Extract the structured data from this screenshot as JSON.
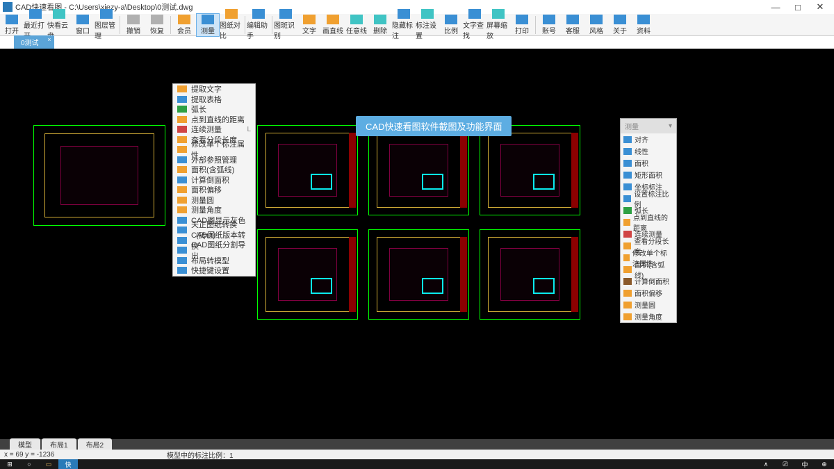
{
  "title": "CAD快速看图 - C:\\Users\\xiezy-a\\Desktop\\0测试.dwg",
  "winbtns": {
    "min": "—",
    "max": "□",
    "close": "✕"
  },
  "toolbar": [
    {
      "id": "open",
      "label": "打开",
      "c": "c-blue"
    },
    {
      "id": "recent",
      "label": "最近打开",
      "c": "c-blue"
    },
    {
      "id": "cloud",
      "label": "快看云盘",
      "c": "c-cyan"
    },
    {
      "id": "window",
      "label": "窗口",
      "c": "c-blue"
    },
    {
      "id": "layer",
      "label": "图层管理",
      "c": "c-blue"
    },
    {
      "sep": true
    },
    {
      "id": "undo",
      "label": "撤销",
      "c": "c-gray"
    },
    {
      "id": "redo",
      "label": "恢复",
      "c": "c-gray"
    },
    {
      "sep": true
    },
    {
      "id": "vip",
      "label": "会员",
      "c": "c-orange"
    },
    {
      "id": "measure",
      "label": "测量",
      "c": "c-blue",
      "hl": true
    },
    {
      "id": "compare",
      "label": "图纸对比",
      "c": "c-orange"
    },
    {
      "sep": true
    },
    {
      "id": "edit",
      "label": "编辑助手",
      "c": "c-blue"
    },
    {
      "sep": true
    },
    {
      "id": "imgrec",
      "label": "图斑识别",
      "c": "c-blue"
    },
    {
      "id": "text",
      "label": "文字",
      "c": "c-orange"
    },
    {
      "id": "line",
      "label": "画直线",
      "c": "c-orange"
    },
    {
      "id": "anyline",
      "label": "任意线",
      "c": "c-cyan"
    },
    {
      "id": "delete",
      "label": "删除",
      "c": "c-cyan"
    },
    {
      "id": "hide",
      "label": "隐藏标注",
      "c": "c-blue"
    },
    {
      "id": "annset",
      "label": "标注设置",
      "c": "c-cyan"
    },
    {
      "id": "ratio",
      "label": "比例",
      "c": "c-blue"
    },
    {
      "id": "find",
      "label": "文字查找",
      "c": "c-blue"
    },
    {
      "id": "scale",
      "label": "屏幕缩放",
      "c": "c-cyan"
    },
    {
      "id": "print",
      "label": "打印",
      "c": "c-blue"
    },
    {
      "sep": true
    },
    {
      "id": "account",
      "label": "账号",
      "c": "c-blue"
    },
    {
      "id": "service",
      "label": "客服",
      "c": "c-blue"
    },
    {
      "id": "style",
      "label": "风格",
      "c": "c-blue"
    },
    {
      "id": "about",
      "label": "关于",
      "c": "c-blue"
    },
    {
      "id": "material",
      "label": "资料",
      "c": "c-blue"
    }
  ],
  "doctab": {
    "label": "0测试",
    "close": "×"
  },
  "dropdown": [
    {
      "label": "提取文字",
      "c": "c-orange"
    },
    {
      "label": "提取表格",
      "c": "c-blue"
    },
    {
      "label": "弧长",
      "c": "c-green"
    },
    {
      "label": "点到直线的距离",
      "c": "c-orange"
    },
    {
      "label": "连续测量",
      "key": "L",
      "c": "c-red"
    },
    {
      "label": "查看分段长度",
      "c": "c-orange"
    },
    {
      "label": "修改单个标注属性",
      "c": "c-orange"
    },
    {
      "label": "外部参照管理",
      "c": "c-blue"
    },
    {
      "label": "面积(含弧线)",
      "c": "c-orange"
    },
    {
      "label": "计算倒面积",
      "c": "c-blue"
    },
    {
      "label": "面积偏移",
      "c": "c-orange"
    },
    {
      "label": "测量圆",
      "c": "c-orange"
    },
    {
      "label": "测量角度",
      "c": "c-orange"
    },
    {
      "label": "CAD图显示灰色",
      "c": "c-blue"
    },
    {
      "label": "天正图纸转换（砖t3）",
      "c": "c-blue"
    },
    {
      "label": "CAD图纸版本转换",
      "c": "c-blue"
    },
    {
      "label": "CAD图纸分割导出",
      "c": "c-blue"
    },
    {
      "label": "布局转模型",
      "c": "c-blue"
    },
    {
      "label": "快捷键设置",
      "c": "c-blue"
    }
  ],
  "banner": "CAD快速看图软件截图及功能界面",
  "panel": {
    "header": "测量",
    "items": [
      {
        "label": "对齐",
        "c": "c-blue"
      },
      {
        "label": "线性",
        "c": "c-blue"
      },
      {
        "label": "面积",
        "c": "c-blue"
      },
      {
        "label": "矩形面积",
        "c": "c-blue"
      },
      {
        "label": "坐标标注",
        "c": "c-blue"
      },
      {
        "label": "设置标注比例",
        "c": "c-blue"
      },
      {
        "label": "弧长",
        "c": "c-green"
      },
      {
        "label": "点到直线的距离",
        "c": "c-orange"
      },
      {
        "label": "连续测量",
        "c": "c-red"
      },
      {
        "label": "查看分段长度",
        "c": "c-orange"
      },
      {
        "label": "修改单个标注属性",
        "c": "c-orange"
      },
      {
        "label": "面积(含弧线)",
        "c": "c-orange"
      },
      {
        "label": "计算倒面积",
        "c": "c-brown"
      },
      {
        "label": "面积偏移",
        "c": "c-orange"
      },
      {
        "label": "测量圆",
        "c": "c-orange"
      },
      {
        "label": "测量角度",
        "c": "c-orange"
      }
    ]
  },
  "bottomtabs": [
    "模型",
    "布局1",
    "布局2"
  ],
  "status": {
    "coords": "x = 69  y = -1236",
    "info": "模型中的标注比例：1"
  },
  "taskbar_right": [
    "∧",
    "⎚",
    "中",
    "⊕"
  ]
}
